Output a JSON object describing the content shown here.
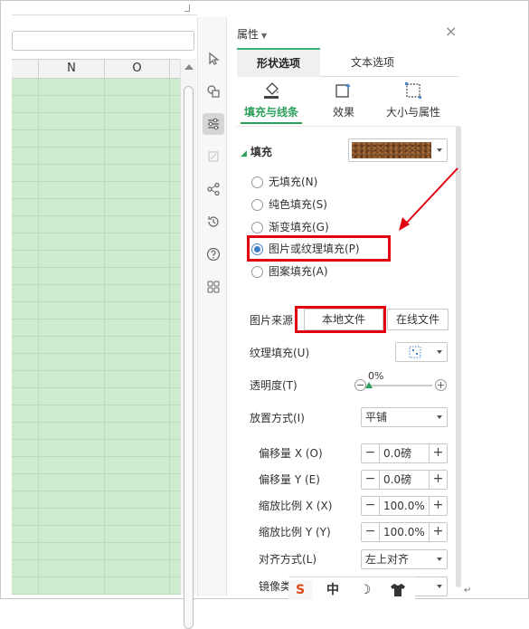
{
  "spreadsheet": {
    "columns": [
      "N",
      "O"
    ]
  },
  "toolstrip": {
    "tools": [
      "select-cursor-icon",
      "shapes-icon",
      "properties-icon",
      "transform-icon",
      "share-icon",
      "history-icon",
      "help-icon",
      "apps-grid-icon"
    ]
  },
  "pane": {
    "title": "属性",
    "tabs": {
      "shape_options": "形状选项",
      "text_options": "文本选项"
    },
    "subtabs": {
      "fill_line": "填充与线条",
      "effects": "效果",
      "size_props": "大小与属性"
    },
    "fill": {
      "heading": "填充",
      "options": [
        "无填充(N)",
        "纯色填充(S)",
        "渐变填充(G)",
        "图片或纹理填充(P)",
        "图案填充(A)"
      ],
      "selected_index": 3
    },
    "picture_source": {
      "label": "图片来源",
      "local_file": "本地文件",
      "online_file": "在线文件"
    },
    "texture": {
      "label": "纹理填充(U)"
    },
    "transparency": {
      "label": "透明度(T)",
      "value": "0%",
      "level_percent": 0
    },
    "placement": {
      "label": "放置方式(I)",
      "value": "平铺"
    },
    "offset_x": {
      "label": "偏移量 X (O)",
      "value": "0.0磅"
    },
    "offset_y": {
      "label": "偏移量 Y (E)",
      "value": "0.0磅"
    },
    "scale_x": {
      "label": "缩放比例 X (X)",
      "value": "100.0%"
    },
    "scale_y": {
      "label": "缩放比例 Y (Y)",
      "value": "100.0%"
    },
    "alignment": {
      "label": "对齐方式(L)",
      "value": "左上对齐"
    },
    "mirror": {
      "label": "镜像类"
    }
  },
  "ime": {
    "items": [
      "S",
      "中",
      "☽",
      "shirt-icon"
    ]
  },
  "colors": {
    "accent_green": "#2ca05a",
    "highlight_red": "#e0000f",
    "grid_green": "#cdeccf",
    "radio_blue": "#3d7cc9"
  }
}
